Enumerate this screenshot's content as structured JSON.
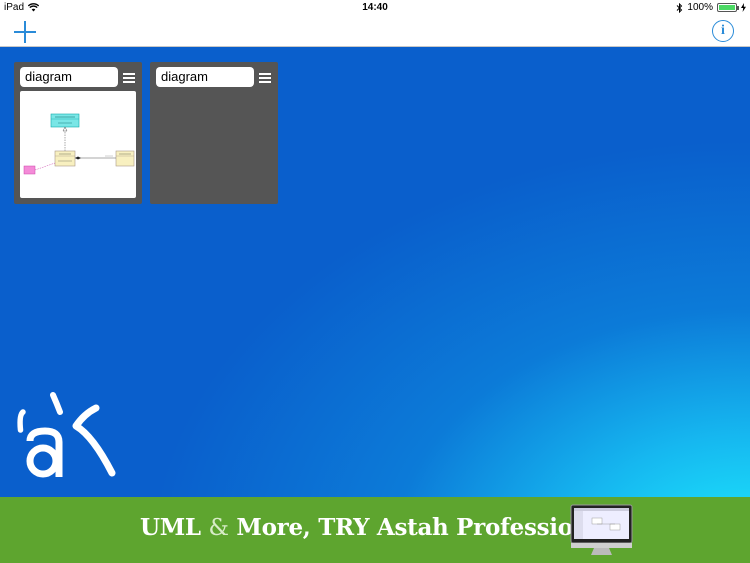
{
  "status_bar": {
    "device": "iPad",
    "time": "14:40",
    "battery": "100%",
    "battery_level": 1.0
  },
  "nav": {
    "add_icon": "plus-icon",
    "info_icon": "info-icon",
    "info_glyph": "i",
    "accent_color": "#2a8bd8"
  },
  "diagrams": [
    {
      "title": "diagram",
      "has_thumbnail": true
    },
    {
      "title": "diagram",
      "has_thumbnail": false
    }
  ],
  "banner": {
    "text_before": "UML",
    "amp": "&",
    "text_after": "More, TRY Astah Professional",
    "background_color": "#5ea52f"
  }
}
